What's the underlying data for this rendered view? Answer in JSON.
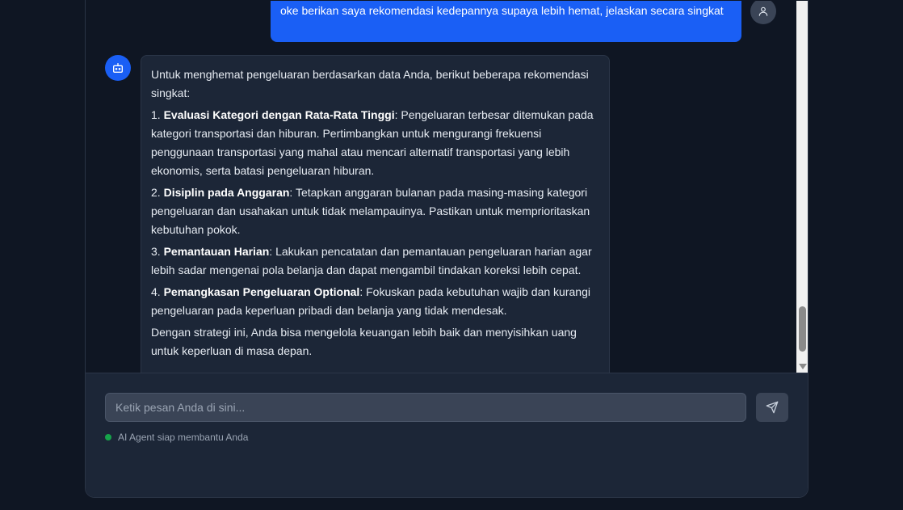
{
  "conversation": {
    "user_message": "oke berikan saya rekomendasi kedepannya supaya lebih hemat, jelaskan secara singkat",
    "assistant_message": {
      "intro": "Untuk menghemat pengeluaran berdasarkan data Anda, berikut beberapa rekomendasi singkat:",
      "items": [
        {
          "number": "1.",
          "title": "Evaluasi Kategori dengan Rata-Rata Tinggi",
          "text": ": Pengeluaran terbesar ditemukan pada kategori transportasi dan hiburan. Pertimbangkan untuk mengurangi frekuensi penggunaan transportasi yang mahal atau mencari alternatif transportasi yang lebih ekonomis, serta batasi pengeluaran hiburan."
        },
        {
          "number": "2.",
          "title": "Disiplin pada Anggaran",
          "text": ": Tetapkan anggaran bulanan pada masing-masing kategori pengeluaran dan usahakan untuk tidak melampauinya. Pastikan untuk memprioritaskan kebutuhan pokok."
        },
        {
          "number": "3.",
          "title": "Pemantauan Harian",
          "text": ": Lakukan pencatatan dan pemantauan pengeluaran harian agar lebih sadar mengenai pola belanja dan dapat mengambil tindakan koreksi lebih cepat."
        },
        {
          "number": "4.",
          "title": "Pemangkasan Pengeluaran Optional",
          "text": ": Fokuskan pada kebutuhan wajib dan kurangi pengeluaran pada keperluan pribadi dan belanja yang tidak mendesak."
        }
      ],
      "closing": "Dengan strategi ini, Anda bisa mengelola keuangan lebih baik dan menyisihkan uang untuk keperluan di masa depan."
    }
  },
  "input": {
    "placeholder": "Ketik pesan Anda di sini...",
    "value": ""
  },
  "status": {
    "text": "AI Agent siap membantu Anda",
    "color": "#16a34a"
  },
  "colors": {
    "accent": "#1a5ff5",
    "background": "#0f1623",
    "panel": "#1c2637"
  },
  "icons": {
    "user_avatar": "user-icon",
    "bot_avatar": "bot-icon",
    "send": "send-icon"
  }
}
